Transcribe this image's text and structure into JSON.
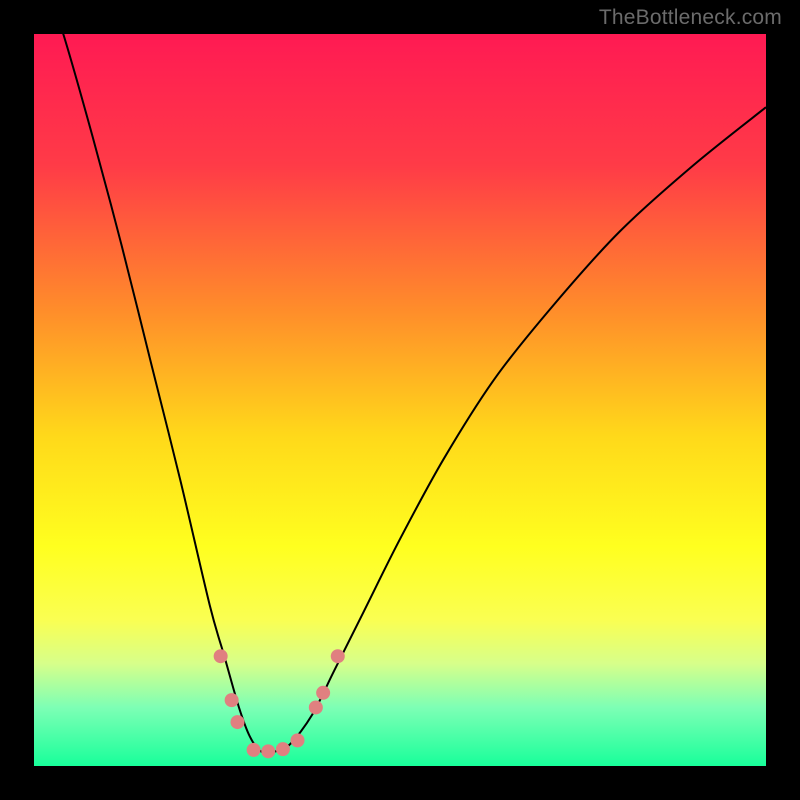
{
  "watermark": "TheBottleneck.com",
  "chart_data": {
    "type": "line",
    "title": "",
    "xlabel": "",
    "ylabel": "",
    "xlim": [
      0,
      100
    ],
    "ylim": [
      0,
      100
    ],
    "grid": false,
    "legend": false,
    "background_gradient": {
      "stops": [
        {
          "offset": 0,
          "color": "#ff1a53"
        },
        {
          "offset": 18,
          "color": "#ff3b47"
        },
        {
          "offset": 38,
          "color": "#ff8e2a"
        },
        {
          "offset": 55,
          "color": "#ffd91a"
        },
        {
          "offset": 70,
          "color": "#ffff1f"
        },
        {
          "offset": 80,
          "color": "#faff52"
        },
        {
          "offset": 86,
          "color": "#d7ff8a"
        },
        {
          "offset": 92,
          "color": "#7dffb5"
        },
        {
          "offset": 100,
          "color": "#18ff9a"
        }
      ]
    },
    "series": [
      {
        "name": "bottleneck-curve",
        "color": "#000000",
        "x": [
          0,
          4,
          8,
          12,
          16,
          20,
          24,
          26,
          28,
          29.5,
          31,
          33,
          35,
          38,
          41,
          45,
          50,
          56,
          63,
          71,
          80,
          90,
          100
        ],
        "y": [
          112,
          100,
          86,
          71,
          55,
          39,
          22,
          15,
          8,
          4,
          2,
          2,
          3,
          7,
          13,
          21,
          31,
          42,
          53,
          63,
          73,
          82,
          90
        ]
      }
    ],
    "markers": {
      "color": "#e08080",
      "radius_px": 7,
      "points": [
        {
          "x": 25.5,
          "y": 15
        },
        {
          "x": 27.0,
          "y": 9
        },
        {
          "x": 27.8,
          "y": 6
        },
        {
          "x": 30.0,
          "y": 2.2
        },
        {
          "x": 32.0,
          "y": 2.0
        },
        {
          "x": 34.0,
          "y": 2.3
        },
        {
          "x": 36.0,
          "y": 3.5
        },
        {
          "x": 38.5,
          "y": 8
        },
        {
          "x": 39.5,
          "y": 10
        },
        {
          "x": 41.5,
          "y": 15
        }
      ]
    }
  }
}
